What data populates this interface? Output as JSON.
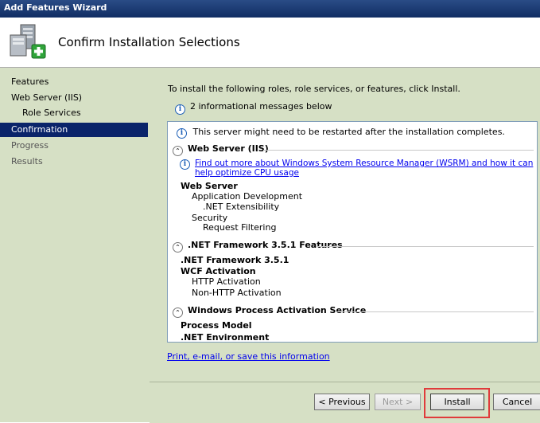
{
  "window": {
    "title": "Add Features Wizard"
  },
  "header": {
    "title": "Confirm Installation Selections",
    "icon": "server-add-icon"
  },
  "nav": {
    "items": [
      {
        "label": "Features",
        "state": "normal"
      },
      {
        "label": "Web Server (IIS)",
        "state": "normal"
      },
      {
        "label": "Role Services",
        "state": "normal"
      },
      {
        "label": "Confirmation",
        "state": "active"
      },
      {
        "label": "Progress",
        "state": "disabled"
      },
      {
        "label": "Results",
        "state": "disabled"
      }
    ]
  },
  "main": {
    "intro": "To install the following roles, role services, or features, click Install.",
    "info_summary": "2 informational messages below",
    "restart_msg": "This server might need to be restarted after the installation completes.",
    "sections": {
      "iis": {
        "title": "Web Server (IIS)",
        "wsrm_link": "Find out more about Windows System Resource Manager (WSRM) and how it can help optimize CPU usage",
        "items": [
          "Web Server",
          "Application Development",
          ".NET Extensibility",
          "Security",
          "Request Filtering"
        ]
      },
      "netfx": {
        "title": ".NET Framework 3.5.1 Features",
        "items": [
          ".NET Framework 3.5.1",
          "WCF Activation",
          "HTTP Activation",
          "Non-HTTP Activation"
        ]
      },
      "was": {
        "title": "Windows Process Activation Service",
        "items": [
          "Process Model",
          ".NET Environment"
        ]
      }
    },
    "print_link": "Print, e-mail, or save this information"
  },
  "footer": {
    "previous": "< Previous",
    "next": "Next >",
    "install": "Install",
    "cancel": "Cancel"
  },
  "colors": {
    "accent": "#0a246a",
    "pane_bg": "#d6e0c5",
    "highlight": "#e03b3b",
    "link": "#0000ee"
  }
}
